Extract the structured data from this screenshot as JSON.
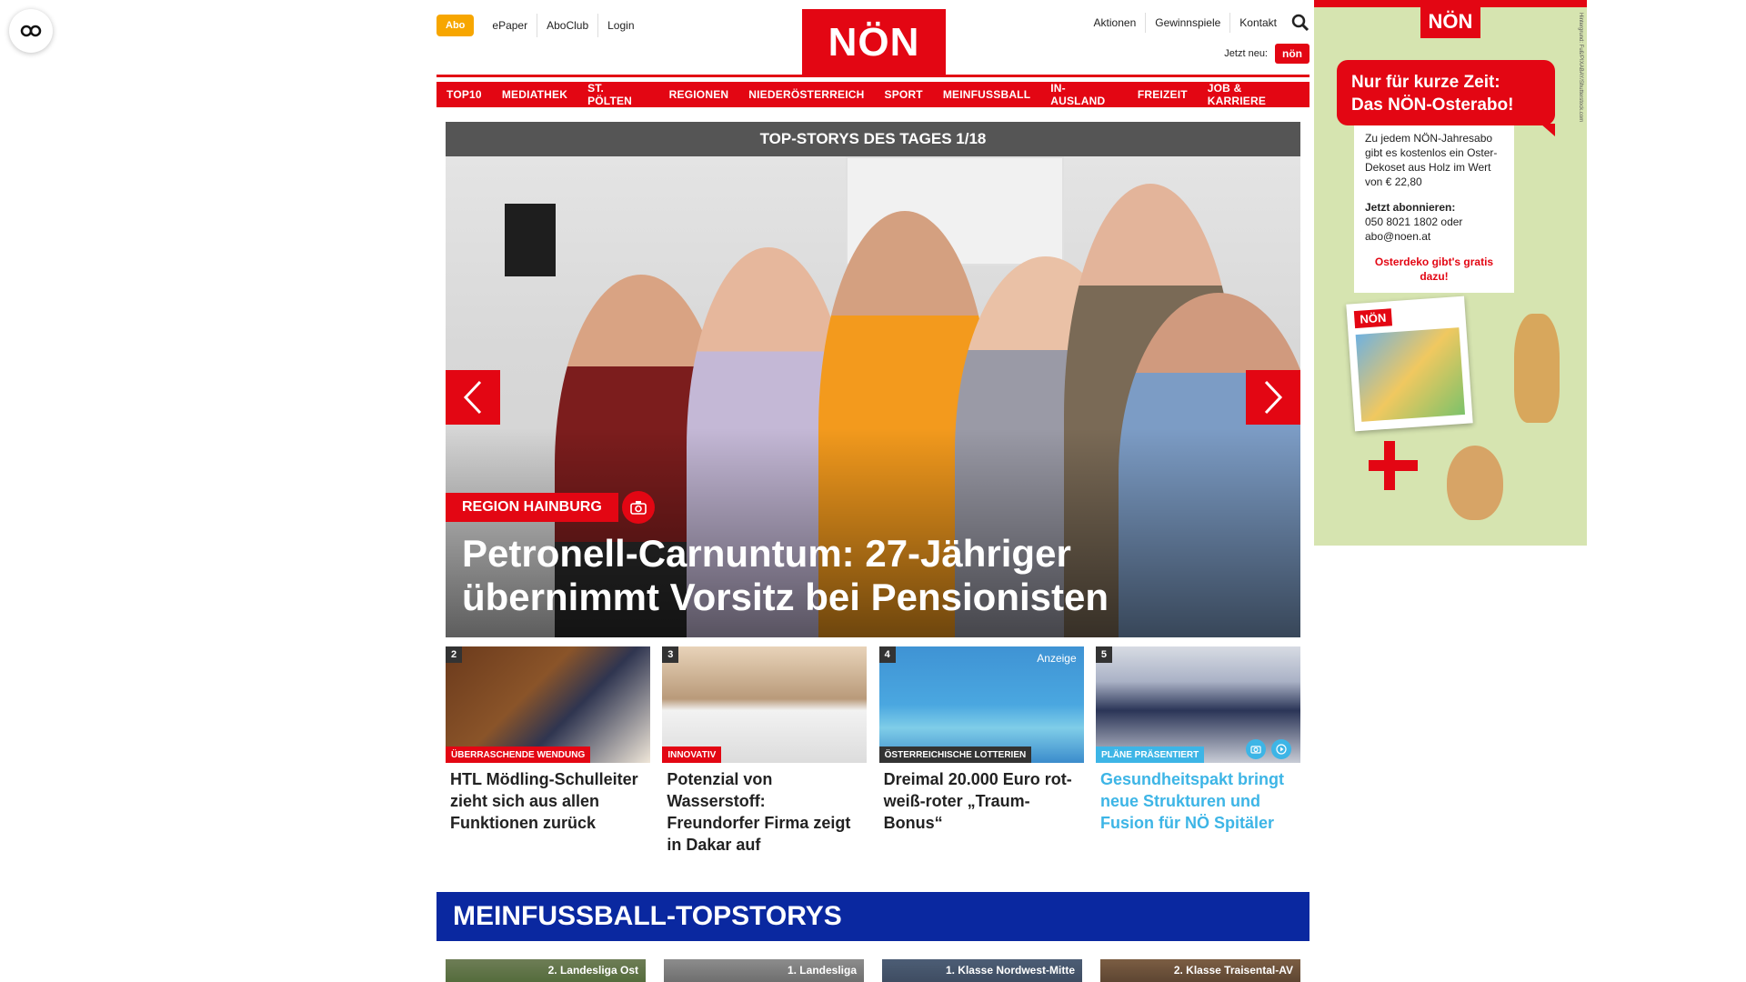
{
  "accessibility": {
    "icon": "glasses-icon"
  },
  "header": {
    "abo_label": "Abo",
    "utility_links_left": [
      "ePaper",
      "AboClub",
      "Login"
    ],
    "logo_text": "NÖN",
    "utility_links_right": [
      "Aktionen",
      "Gewinnspiele",
      "Kontakt"
    ],
    "jetzt_neu_label": "Jetzt neu:",
    "jetzt_neu_badge": "nön"
  },
  "nav": {
    "items": [
      "TOP10",
      "MEDIATHEK",
      "ST. PÖLTEN",
      "REGIONEN",
      "NIEDERÖSTERREICH",
      "SPORT",
      "MEINFUSSBALL",
      "IN-AUSLAND",
      "FREIZEIT",
      "JOB & KARRIERE"
    ]
  },
  "hero": {
    "title": "TOP-STORYS DES TAGES 1/18",
    "tag": "REGION HAINBURG",
    "headline": "Petronell-Carnuntum: 27-Jähriger übernimmt Vorsitz bei Pensionisten"
  },
  "teasers": [
    {
      "num": "2",
      "tag": "ÜBERRASCHENDE WENDUNG",
      "tag_color": "#e30613",
      "title": "HTL Mödling-Schulleiter zieht sich aus allen Funktionen zurück",
      "title_color": "#222222"
    },
    {
      "num": "3",
      "tag": "INNOVATIV",
      "tag_color": "#e30613",
      "title": "Potenzial von Wasserstoff: Freundorfer Firma zeigt in Dakar auf",
      "title_color": "#222222"
    },
    {
      "num": "4",
      "tag": "ÖSTERREICHISCHE LOTTERIEN",
      "tag_color": "#333333",
      "anzeige": "Anzeige",
      "title": "Dreimal 20.000 Euro rot-weiß-roter „Traum-Bonus“",
      "title_color": "#222222"
    },
    {
      "num": "5",
      "tag": "PLÄNE PRÄSENTIERT",
      "tag_color": "#3db5e6",
      "title": "Gesundheitspakt bringt neue Strukturen und Fusion für NÖ Spitäler",
      "title_color": "#3db5e6"
    }
  ],
  "fussball": {
    "header": "MEINFUSSBALL-TOPSTORYS",
    "cards": [
      "2. Landesliga Ost",
      "1. Landesliga",
      "1. Klasse Nordwest-Mitte",
      "2. Klasse Traisental-AV"
    ]
  },
  "ad": {
    "logo": "NÖN",
    "headline_1": "Nur für kurze Zeit:",
    "headline_2": "Das NÖN-Osterabo!",
    "body": "Zu jedem NÖN-Jahresabo gibt es kostenlos ein Oster-Dekoset aus Holz im Wert von € 22,80",
    "cta_heading": "Jetzt abonnieren:",
    "cta_text": "050 8021 1802 oder abo@noen.at",
    "red_text": "Osterdeko gibt's gratis dazu!",
    "paper_logo": "NÖN",
    "credit": "Hintergrund: Fuß/PIXABAY/Shutterstock.com"
  },
  "colors": {
    "brand_red": "#e30613",
    "abo_orange": "#f7a600",
    "fussball_blue": "#0a28a0",
    "accent_blue": "#3db5e6"
  }
}
